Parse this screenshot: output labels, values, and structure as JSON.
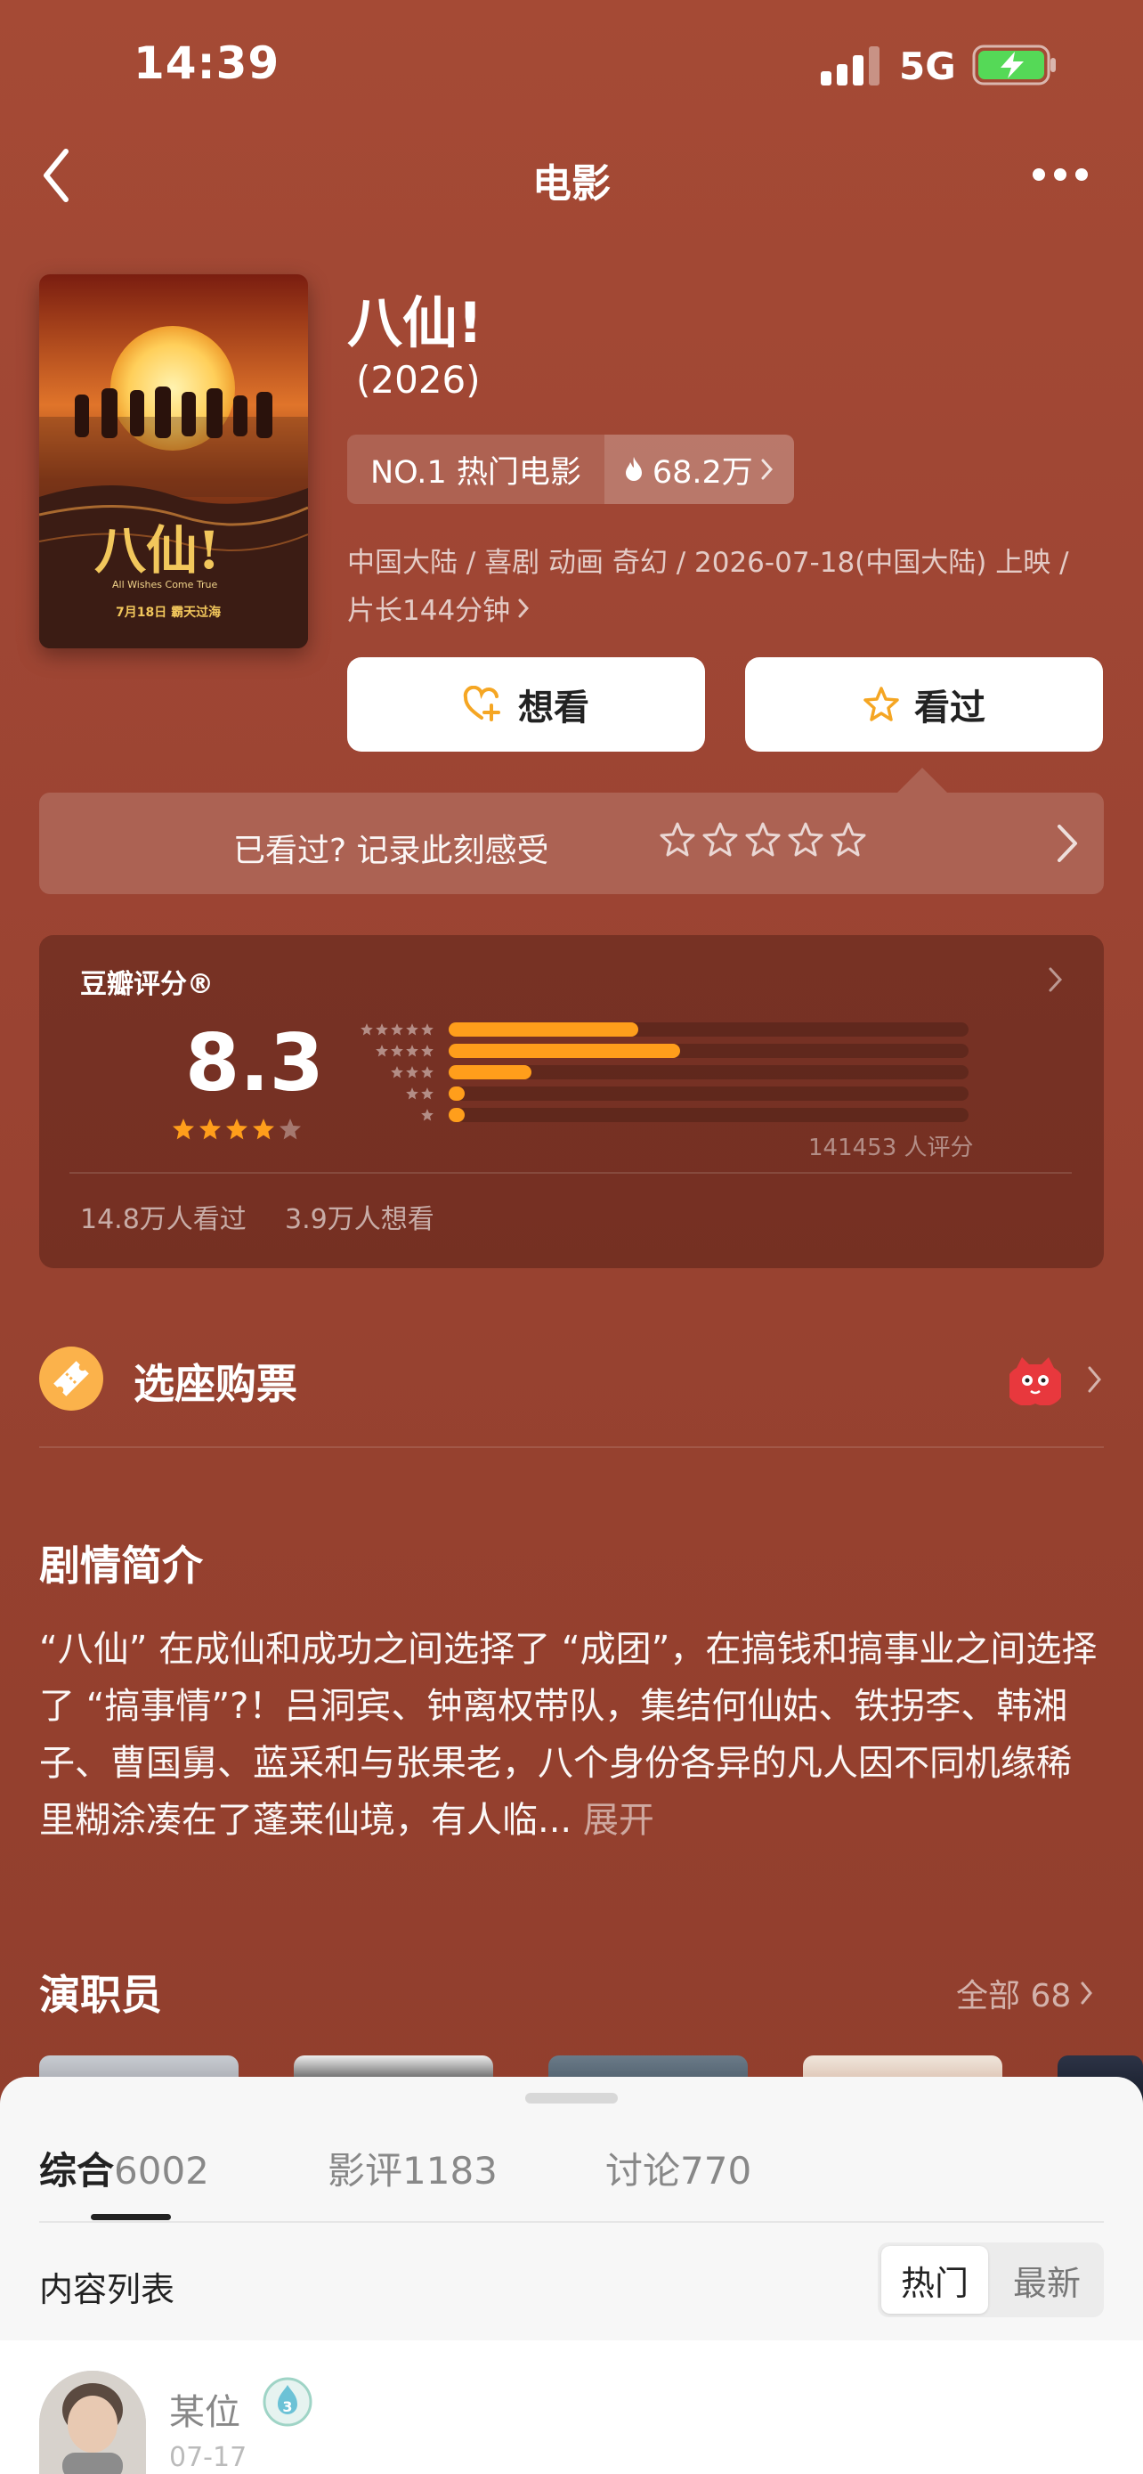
{
  "status_bar": {
    "time": "14:39",
    "network": "5G"
  },
  "nav": {
    "title": "电影"
  },
  "movie": {
    "title": "八仙!",
    "year": "(2026)",
    "rank_label": "NO.1 热门电影",
    "heat": "68.2万",
    "meta_line1": "中国大陆 / 喜剧 动画 奇幻 / 2026-07-18(中国大陆) 上映 /",
    "meta_line2": "片长144分钟",
    "poster_title": "八仙!",
    "poster_subtitle": "All Wishes Come True",
    "poster_date": "7月18日 霸天过海"
  },
  "actions": {
    "want_label": "想看",
    "seen_label": "看过"
  },
  "record": {
    "text": "已看过? 记录此刻感受"
  },
  "rating": {
    "label": "豆瓣评分®",
    "score": "8.3",
    "stars_value": 4.0,
    "distribution": [
      {
        "stars": 5,
        "fraction": 0.365
      },
      {
        "stars": 4,
        "fraction": 0.445
      },
      {
        "stars": 3,
        "fraction": 0.16
      },
      {
        "stars": 2,
        "fraction": 0.03
      },
      {
        "stars": 1,
        "fraction": 0.03
      }
    ],
    "count_text": "141453 人评分",
    "seen_text": "14.8万人看过",
    "want_text": "3.9万人想看"
  },
  "ticket": {
    "label": "选座购票"
  },
  "synopsis": {
    "title": "剧情简介",
    "text": "“八仙” 在成仙和成功之间选择了 “成团”，在搞钱和搞事业之间选择了 “搞事情”?！吕洞宾、钟离权带队，集结何仙姑、铁拐李、韩湘子、曹国舅、蓝采和与张果老，八个身份各异的凡人因不同机缘稀里糊涂凑在了蓬莱仙境，有人临...",
    "expand": "展开"
  },
  "cast": {
    "title": "演职员",
    "all": "全部 68"
  },
  "sheet": {
    "tabs": [
      {
        "label": "综合",
        "count": "6002"
      },
      {
        "label": "影评",
        "count": "1183"
      },
      {
        "label": "讨论",
        "count": "770"
      }
    ],
    "list_title": "内容列表",
    "sort_hot": "热门",
    "sort_new": "最新",
    "post": {
      "user": "某位",
      "level": "3",
      "date": "07-17"
    }
  },
  "colors": {
    "accent": "#ff9e1b",
    "background": "#9c4433"
  }
}
